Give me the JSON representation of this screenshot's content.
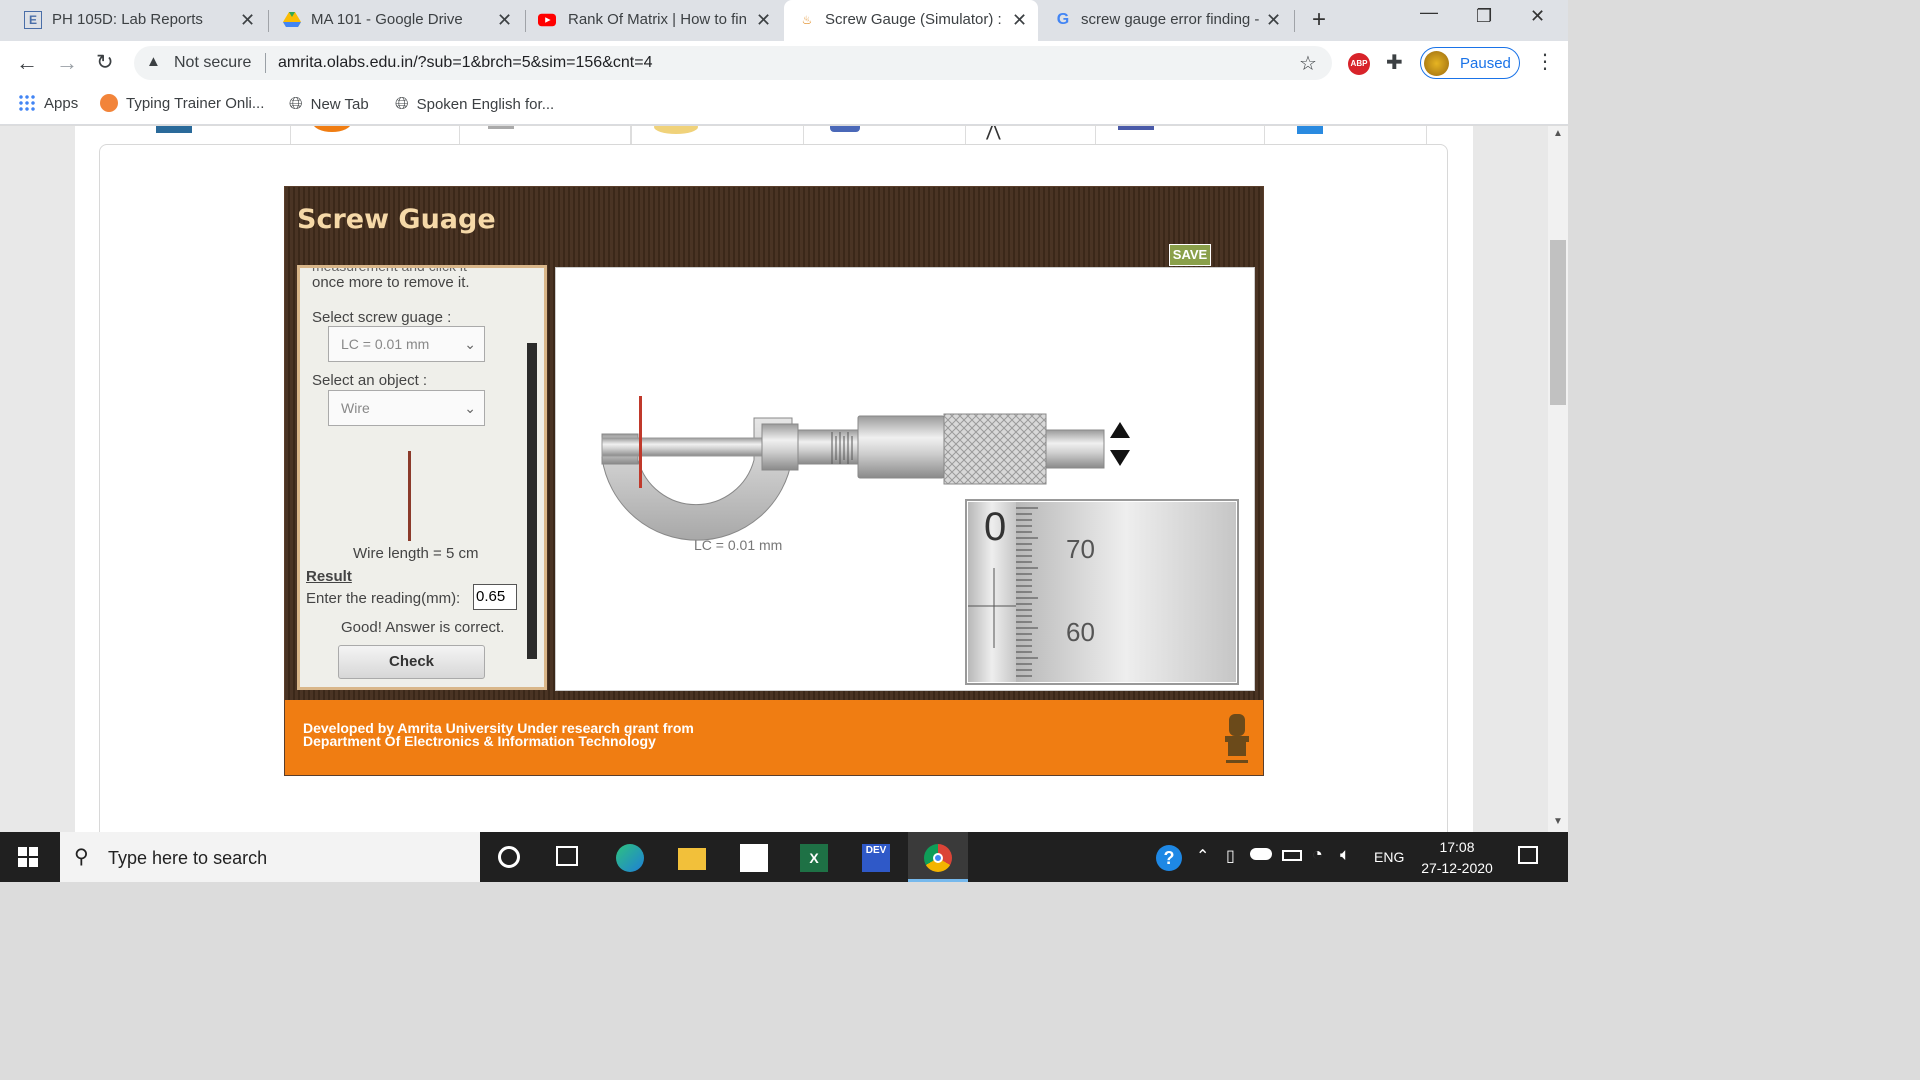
{
  "tabs": [
    {
      "title": "PH 105D: Lab Reports",
      "favicon": "E"
    },
    {
      "title": "MA 101 - Google Drive",
      "favicon": "drive-icon"
    },
    {
      "title": "Rank Of Matrix | How to fin",
      "favicon": "youtube-icon"
    },
    {
      "title": "Screw Gauge (Simulator) : C",
      "favicon": "olabs-icon",
      "active": true
    },
    {
      "title": "screw gauge error finding -",
      "favicon": "google-icon"
    }
  ],
  "address": {
    "security": "Not secure",
    "url": "amrita.olabs.edu.in/?sub=1&brch=5&sim=156&cnt=4"
  },
  "profile": {
    "label": "Paused"
  },
  "bookmarks": [
    {
      "label": "Apps"
    },
    {
      "label": "Typing Trainer Onli..."
    },
    {
      "label": "New Tab"
    },
    {
      "label": "Spoken English for..."
    }
  ],
  "sim": {
    "title": "Screw Guage",
    "save_label": "SAVE",
    "instructions_tail": "once more to remove it.",
    "select_gauge_label": "Select screw guage :",
    "selected_gauge": "LC = 0.01 mm",
    "select_object_label": "Select an object :",
    "selected_object": "Wire",
    "wire_length": "Wire length = 5 cm",
    "result_label": "Result",
    "reading_label": "Enter the reading(mm):",
    "reading_value": "0.65",
    "feedback": "Good! Answer is correct.",
    "check_label": "Check",
    "gauge_lc_label": "LC = 0.01 mm",
    "zoom_main_scale": "0",
    "zoom_thimble_upper": "70",
    "zoom_thimble_lower": "60",
    "footer_line1": "Developed by Amrita University Under research grant from",
    "footer_line2": "Department Of Electronics & Information Technology"
  },
  "taskbar": {
    "search_placeholder": "Type here to search",
    "lang": "ENG",
    "time": "17:08",
    "date": "27-12-2020"
  },
  "colors": {
    "header_brown": "#3b2819",
    "title_text": "#f6d9a8",
    "footer_orange": "#f07d12",
    "save_green": "#8aa04a"
  }
}
